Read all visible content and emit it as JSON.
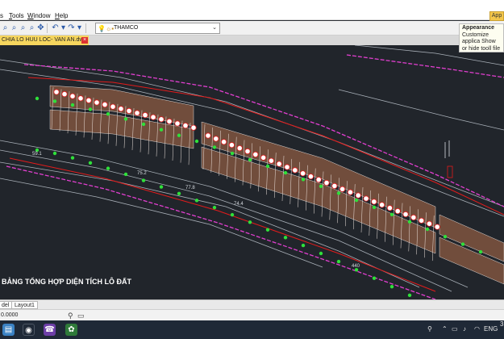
{
  "menu": {
    "items": [
      {
        "pre": "",
        "underlined": "T",
        "post": "ools",
        "x": 11
      },
      {
        "pre": "",
        "underlined": "W",
        "post": "indow",
        "x": 34
      },
      {
        "pre": "",
        "underlined": "H",
        "post": "elp",
        "x": 68
      }
    ],
    "appearance_button": "App"
  },
  "toolbar": {
    "layer_name": "THAMCO"
  },
  "tooltip": {
    "title": "Appearance",
    "body": "Customize applica Show or hide tooll file tabs."
  },
  "file_tab": {
    "name": "CHIA LO HUU LOC- VAN AN.dwg",
    "close": "×"
  },
  "drawing": {
    "title": "BẢNG TỔNG HỢP DIỆN TÍCH LÔ ĐẤT",
    "dimension_labels": [
      "59.1",
      "75.2",
      "77.8",
      "74.4",
      "440",
      "8.0",
      "5.0"
    ],
    "colors": {
      "background": "#21252b",
      "lot_hatch": "#b5704a",
      "boundary": "#e23fd0",
      "redline": "#e31b1b",
      "points": "#2fe03a",
      "street_line": "#a9b0b8"
    }
  },
  "layout_tabs": [
    "del",
    "Layout1"
  ],
  "status": {
    "coordinates": "0.0000"
  },
  "taskbar": {
    "language": "ENG",
    "clock": "3"
  }
}
